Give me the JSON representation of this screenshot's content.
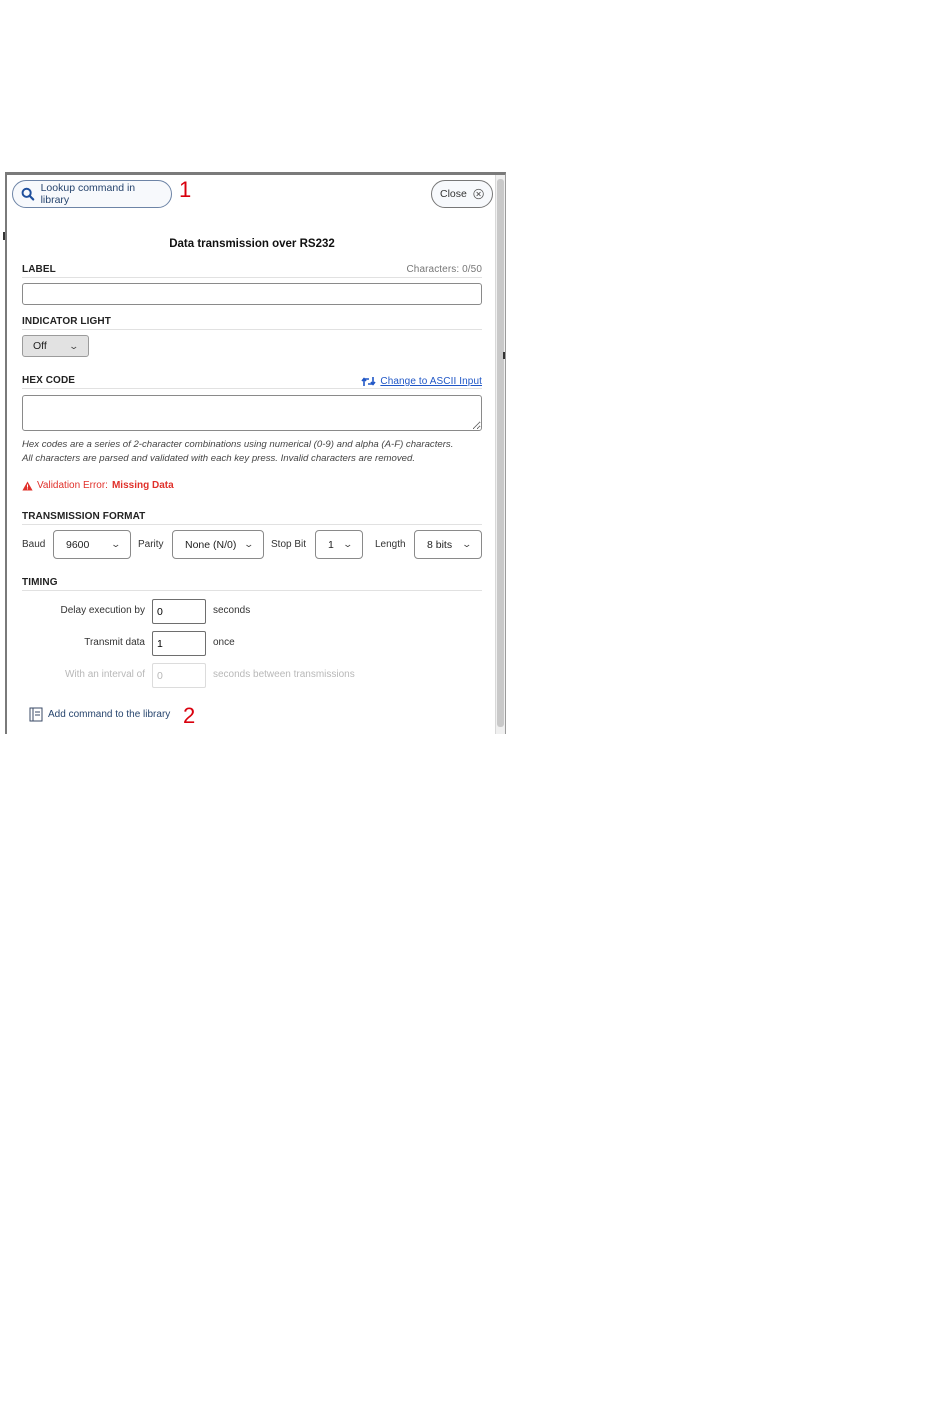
{
  "header": {
    "lookup_label": "Lookup command in library",
    "close_label": "Close",
    "annotation_1": "1",
    "annotation_2": "2"
  },
  "title": "Data transmission over RS232",
  "label_section": {
    "heading": "LABEL",
    "char_count": "Characters: 0/50",
    "value": ""
  },
  "indicator": {
    "heading": "INDICATOR LIGHT",
    "value": "Off"
  },
  "hex": {
    "heading": "HEX CODE",
    "switch_link": "Change to ASCII Input",
    "value": "",
    "hint_line1": "Hex codes are a series of 2-character combinations using numerical (0-9) and alpha (A-F) characters.",
    "hint_line2": "All characters are parsed and validated with each key press. Invalid characters are removed.",
    "error_prefix": "Validation Error:",
    "error_detail": "Missing Data"
  },
  "format": {
    "heading": "TRANSMISSION FORMAT",
    "baud_label": "Baud",
    "baud_value": "9600",
    "parity_label": "Parity",
    "parity_value": "None (N/0)",
    "stop_label": "Stop Bit",
    "stop_value": "1",
    "length_label": "Length",
    "length_value": "8 bits"
  },
  "timing": {
    "heading": "TIMING",
    "delay_label": "Delay execution by",
    "delay_value": "0",
    "delay_unit": "seconds",
    "transmit_label": "Transmit data",
    "transmit_value": "1",
    "transmit_unit": "once",
    "interval_label": "With an interval of",
    "interval_value": "0",
    "interval_unit": "seconds between transmissions"
  },
  "footer": {
    "add_label": "Add command to the library"
  }
}
